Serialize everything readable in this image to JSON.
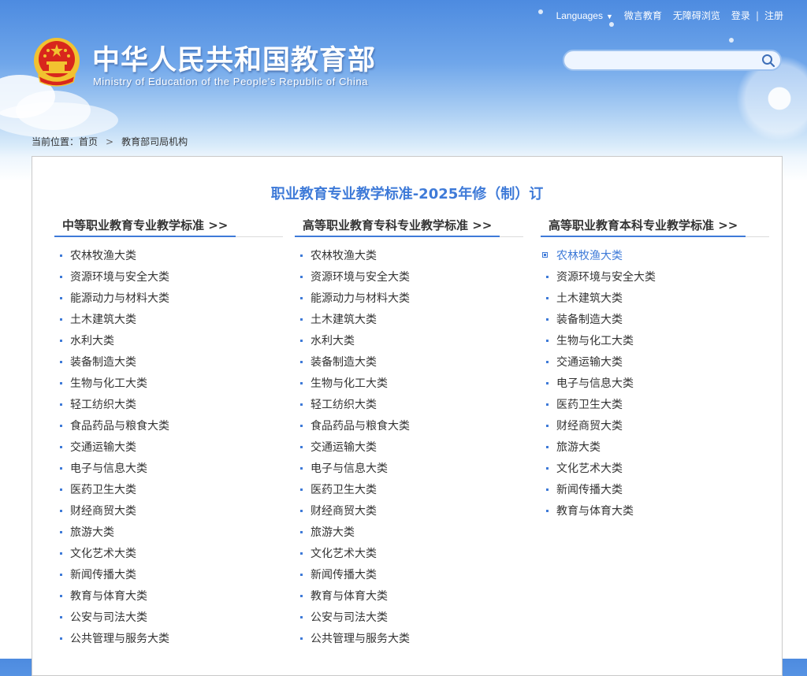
{
  "header": {
    "nav": {
      "languages": "Languages",
      "weiyan": "微言教育",
      "accessible": "无障碍浏览",
      "login": "登录",
      "separator": "|",
      "register": "注册"
    },
    "title_cn": "中华人民共和国教育部",
    "title_en": "Ministry of Education of the People's Republic of China",
    "search": {
      "placeholder": ""
    }
  },
  "breadcrumb": {
    "label": "当前位置：",
    "home": "首页",
    "arrow": ">",
    "current": "教育部司局机构"
  },
  "main": {
    "title": "职业教育专业教学标准-2025年修（制）订",
    "columns": [
      {
        "heading": "中等职业教育专业教学标准 >>",
        "items": [
          "农林牧渔大类",
          "资源环境与安全大类",
          "能源动力与材料大类",
          "土木建筑大类",
          "水利大类",
          "装备制造大类",
          "生物与化工大类",
          "轻工纺织大类",
          "食品药品与粮食大类",
          "交通运输大类",
          "电子与信息大类",
          "医药卫生大类",
          "财经商贸大类",
          "旅游大类",
          "文化艺术大类",
          "新闻传播大类",
          "教育与体育大类",
          "公安与司法大类",
          "公共管理与服务大类"
        ]
      },
      {
        "heading": "高等职业教育专科专业教学标准 >>",
        "items": [
          "农林牧渔大类",
          "资源环境与安全大类",
          "能源动力与材料大类",
          "土木建筑大类",
          "水利大类",
          "装备制造大类",
          "生物与化工大类",
          "轻工纺织大类",
          "食品药品与粮食大类",
          "交通运输大类",
          "电子与信息大类",
          "医药卫生大类",
          "财经商贸大类",
          "旅游大类",
          "文化艺术大类",
          "新闻传播大类",
          "教育与体育大类",
          "公安与司法大类",
          "公共管理与服务大类"
        ]
      },
      {
        "heading": "高等职业教育本科专业教学标准 >>",
        "items": [
          "农林牧渔大类",
          "资源环境与安全大类",
          "土木建筑大类",
          "装备制造大类",
          "生物与化工大类",
          "交通运输大类",
          "电子与信息大类",
          "医药卫生大类",
          "财经商贸大类",
          "旅游大类",
          "文化艺术大类",
          "新闻传播大类",
          "教育与体育大类"
        ]
      }
    ]
  },
  "colors": {
    "accent": "#3e7ad8",
    "header_blue": "#4d8be0",
    "emblem_red": "#d8261c",
    "emblem_gold": "#f2c230"
  },
  "icons": {
    "emblem": "national-emblem-icon",
    "search": "search-icon",
    "dropdown": "chevron-down-icon"
  }
}
